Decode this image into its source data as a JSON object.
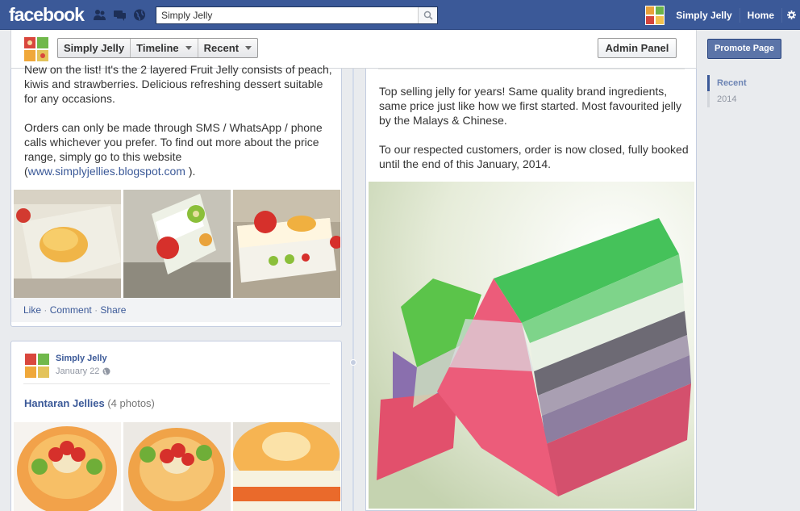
{
  "topbar": {
    "logo": "facebook",
    "search_value": "Simply Jelly",
    "page_name": "Simply Jelly",
    "home_label": "Home"
  },
  "timeline_bar": {
    "page_button": "Simply Jelly",
    "timeline_button": "Timeline",
    "recent_button": "Recent",
    "admin_panel": "Admin Panel"
  },
  "sidebar": {
    "promote": "Promote Page",
    "scrubber": [
      {
        "label": "Recent",
        "active": true
      },
      {
        "label": "2014",
        "active": false
      }
    ]
  },
  "post1": {
    "text_line_partial": "New on the list! It's the 2 layered Fruit Jelly consists of",
    "text_body": "peach, kiwis and strawberries. Delicious refreshing dessert suitable for any occasions.",
    "text_orders": "Orders can only be made through SMS / WhatsApp / phone calls whichever you prefer. To find out more about the price range, simply go to this website (",
    "link": "www.simplyjellies.blogspot.com",
    "link_tail": " ).",
    "actions": {
      "like": "Like",
      "comment": "Comment",
      "share": "Share",
      "sep": "·"
    }
  },
  "post2": {
    "author": "Simply Jelly",
    "date": "January 22",
    "album_title": "Hantaran Jellies",
    "album_count": "(4 photos)"
  },
  "post3": {
    "text1": "Top selling jelly for years! Same quality brand ingredients, same price just like how we first started. Most favourited jelly by the Malays & Chinese.",
    "text2": "To our respected customers, order is now closed, fully booked until the end of this January, 2014."
  },
  "colors": {
    "brand_blue": "#3b5998",
    "link_blue": "#3b5998",
    "background": "#e9ebee"
  }
}
